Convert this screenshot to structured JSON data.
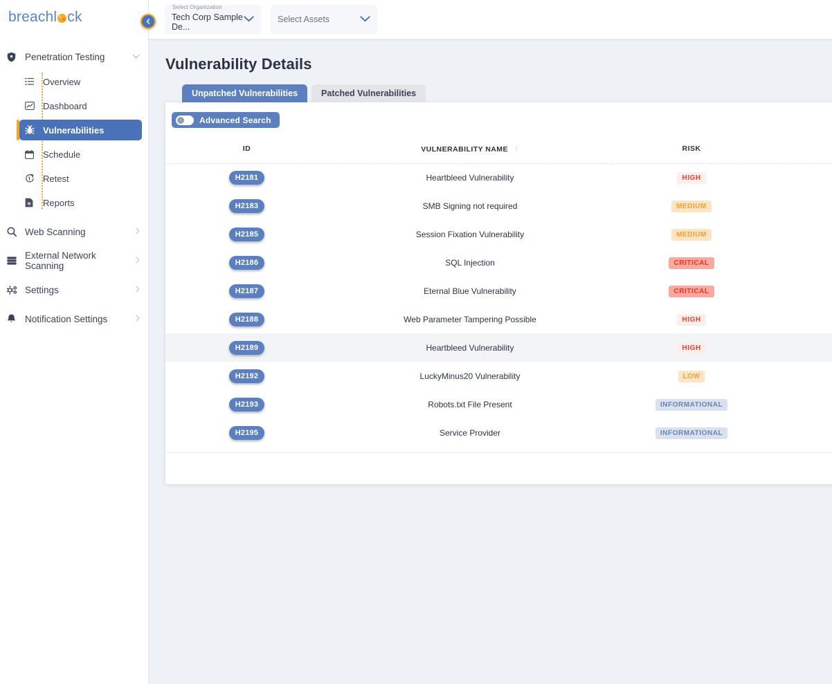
{
  "brand": {
    "name_part1": "breachl",
    "name_part2": "ck"
  },
  "sidebar": {
    "collapse_icon": "chevron-left-icon",
    "group": {
      "label": "Penetration Testing",
      "icon": "shield-icon",
      "chevron": "chevron-down-icon",
      "items": [
        {
          "label": "Overview",
          "icon": "list-icon",
          "active": false
        },
        {
          "label": "Dashboard",
          "icon": "chart-icon",
          "active": false
        },
        {
          "label": "Vulnerabilities",
          "icon": "bug-icon",
          "active": true
        },
        {
          "label": "Schedule",
          "icon": "calendar-icon",
          "active": false
        },
        {
          "label": "Retest",
          "icon": "retest-icon",
          "active": false
        },
        {
          "label": "Reports",
          "icon": "report-icon",
          "active": false
        }
      ]
    },
    "links": [
      {
        "label": "Web Scanning",
        "icon": "search-icon",
        "chevron": "chevron-right-icon"
      },
      {
        "label": "External Network Scanning",
        "icon": "server-icon",
        "chevron": "chevron-right-icon"
      },
      {
        "label": "Settings",
        "icon": "gear-icon",
        "chevron": "chevron-right-icon"
      },
      {
        "label": "Notification Settings",
        "icon": "bell-icon",
        "chevron": "chevron-right-icon"
      }
    ]
  },
  "topbar": {
    "organization": {
      "float_label": "Select Organization",
      "value": "Tech Corp Sample De...",
      "caret_icon": "chevron-down-icon"
    },
    "assets": {
      "placeholder": "Select Assets",
      "caret_icon": "chevron-down-icon"
    }
  },
  "page": {
    "title": "Vulnerability Details",
    "tabs": [
      {
        "label": "Unpatched Vulnerabilities",
        "active": true
      },
      {
        "label": "Patched Vulnerabilities",
        "active": false
      }
    ],
    "advanced_search": {
      "label": "Advanced Search",
      "enabled": false
    }
  },
  "table": {
    "columns": [
      {
        "label": "ID"
      },
      {
        "label": "VULNERABILITY NAME",
        "sort": "ascending",
        "sort_icon": "arrow-up-icon"
      },
      {
        "label": "RISK"
      }
    ],
    "rows": [
      {
        "id": "H2181",
        "name": "Heartbleed Vulnerability",
        "risk": "HIGH",
        "risk_class": "high",
        "highlight": false
      },
      {
        "id": "H2183",
        "name": "SMB Signing not required",
        "risk": "MEDIUM",
        "risk_class": "medium",
        "highlight": false
      },
      {
        "id": "H2185",
        "name": "Session Fixation Vulnerability",
        "risk": "MEDIUM",
        "risk_class": "medium",
        "highlight": false
      },
      {
        "id": "H2186",
        "name": "SQL Injection",
        "risk": "CRITICAL",
        "risk_class": "critical",
        "highlight": false
      },
      {
        "id": "H2187",
        "name": "Eternal Blue Vulnerability",
        "risk": "CRITICAL",
        "risk_class": "critical",
        "highlight": false
      },
      {
        "id": "H2188",
        "name": "Web Parameter Tampering Possible",
        "risk": "HIGH",
        "risk_class": "high",
        "highlight": false
      },
      {
        "id": "H2189",
        "name": "Heartbleed Vulnerability",
        "risk": "HIGH",
        "risk_class": "high",
        "highlight": true
      },
      {
        "id": "H2192",
        "name": "LuckyMinus20 Vulnerability",
        "risk": "LOW",
        "risk_class": "low",
        "highlight": false
      },
      {
        "id": "H2193",
        "name": "Robots.txt File Present",
        "risk": "INFORMATIONAL",
        "risk_class": "informational",
        "highlight": false
      },
      {
        "id": "H2195",
        "name": "Service Provider",
        "risk": "INFORMATIONAL",
        "risk_class": "informational",
        "highlight": false
      }
    ]
  },
  "colors": {
    "brand_blue": "#5b84c4",
    "accent_orange": "#f5a623",
    "active_nav": "#4a72b8",
    "tab_active": "#5b7fbf",
    "page_bg": "#eef2f7",
    "risk_critical_bg": "#fba9a0",
    "risk_critical_fg": "#e03a24",
    "risk_high_bg": "#feeeee",
    "risk_high_fg": "#f0412a",
    "risk_medium_bg": "#fde5c4",
    "risk_medium_fg": "#f5a038",
    "risk_info_bg": "#d9e0ee",
    "risk_info_fg": "#6b83b5"
  }
}
